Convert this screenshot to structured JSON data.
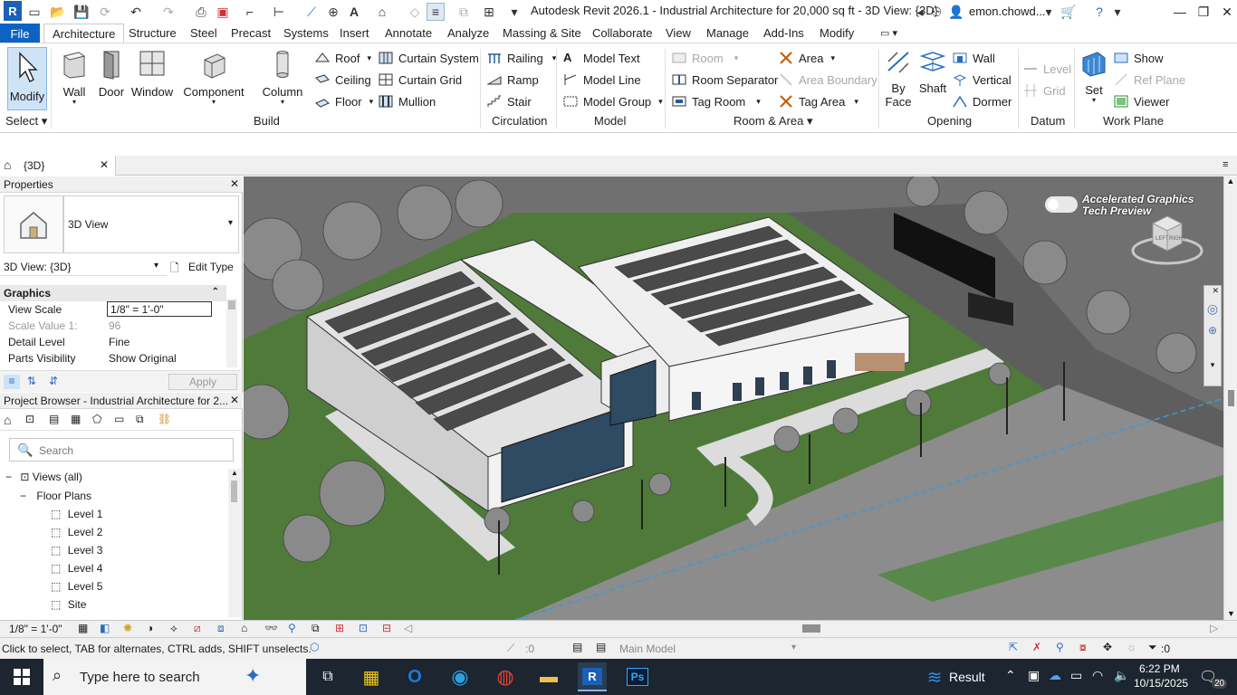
{
  "app": {
    "badge": "R",
    "title": "Autodesk Revit 2026.1 - Industrial Architecture for 20,000 sq ft - 3D View: {3D}",
    "user": "emon.chowd..."
  },
  "tabs": [
    "File",
    "Architecture",
    "Structure",
    "Steel",
    "Precast",
    "Systems",
    "Insert",
    "Annotate",
    "Analyze",
    "Massing & Site",
    "Collaborate",
    "View",
    "Manage",
    "Add-Ins",
    "Modify"
  ],
  "ribbon": {
    "select": {
      "modify": "Modify",
      "group": "Select"
    },
    "build": {
      "group": "Build",
      "wall": "Wall",
      "door": "Door",
      "window": "Window",
      "component": "Component",
      "column": "Column",
      "roof": "Roof",
      "ceiling": "Ceiling",
      "floor": "Floor",
      "curtain_system": "Curtain System",
      "curtain_grid": "Curtain Grid",
      "mullion": "Mullion"
    },
    "circulation": {
      "group": "Circulation",
      "railing": "Railing",
      "ramp": "Ramp",
      "stair": "Stair"
    },
    "model": {
      "group": "Model",
      "model_text": "Model Text",
      "model_line": "Model Line",
      "model_group": "Model Group"
    },
    "room_area": {
      "group": "Room & Area",
      "room": "Room",
      "room_separator": "Room Separator",
      "tag_room": "Tag Room",
      "area": "Area",
      "area_boundary": "Area Boundary",
      "tag_area": "Tag Area"
    },
    "opening": {
      "group": "Opening",
      "by_face_1": "By",
      "by_face_2": "Face",
      "shaft": "Shaft",
      "wall": "Wall",
      "vertical": "Vertical",
      "dormer": "Dormer"
    },
    "datum": {
      "group": "Datum",
      "level": "Level",
      "grid": "Grid"
    },
    "work_plane": {
      "group": "Work Plane",
      "set": "Set",
      "show": "Show",
      "ref_plane": "Ref Plane",
      "viewer": "Viewer"
    }
  },
  "doc_tab": "{3D}",
  "properties": {
    "header": "Properties",
    "type_name": "3D View",
    "instance": "3D View: {3D}",
    "edit_type": "Edit Type",
    "section": "Graphics",
    "rows": [
      {
        "key": "View Scale",
        "value": "1/8\" = 1'-0\""
      },
      {
        "key": "Scale Value    1:",
        "value": "96"
      },
      {
        "key": "Detail Level",
        "value": "Fine"
      },
      {
        "key": "Parts Visibility",
        "value": "Show Original"
      }
    ],
    "apply": "Apply"
  },
  "browser": {
    "header": "Project Browser - Industrial Architecture for 2...",
    "search_placeholder": "Search",
    "views": "Views (all)",
    "floor_plans": "Floor Plans",
    "items": [
      "Level 1",
      "Level 2",
      "Level 3",
      "Level 4",
      "Level 5",
      "Site"
    ]
  },
  "viewport": {
    "banner_line1": "Accelerated Graphics",
    "banner_line2": "Tech Preview",
    "cube_left": "LEFT",
    "cube_right": "RIGHT"
  },
  "view_control": {
    "scale": "1/8\" = 1'-0\""
  },
  "status": {
    "hint": "Click to select, TAB for alternates, CTRL adds, SHIFT unselects.",
    "worksets": ":0",
    "model": "Main Model",
    "filter_count": ":0"
  },
  "taskbar": {
    "search_placeholder": "Type here to search",
    "result": "Result",
    "time": "6:22 PM",
    "date": "10/15/2025",
    "notifications": "20"
  }
}
